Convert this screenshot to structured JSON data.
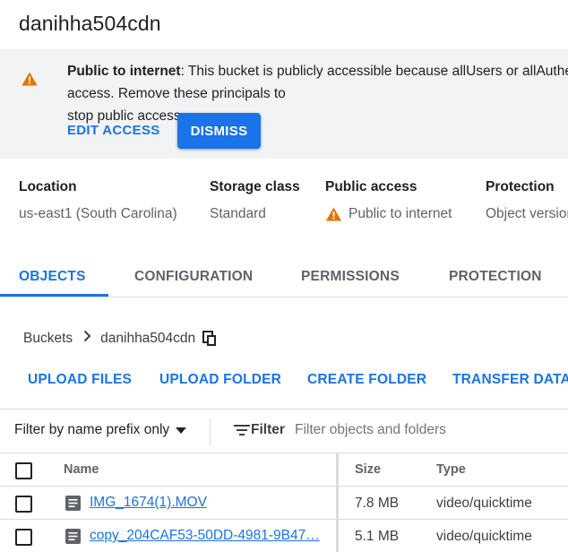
{
  "bucket": {
    "name": "danihha504cdn"
  },
  "banner": {
    "title": "Public to internet",
    "message": ": This bucket is publicly accessible because allUsers or allAuthenticatedUsers have access. Remove these principals to",
    "message_line2": "stop public access.",
    "edit_access_label": "EDIT ACCESS",
    "dismiss_label": "DISMISS",
    "icon": "warning-icon",
    "icon_color": "#e37400"
  },
  "properties": [
    {
      "label": "Location",
      "value": "us-east1 (South Carolina)"
    },
    {
      "label": "Storage class",
      "value": "Standard"
    },
    {
      "label": "Public access",
      "value": "Public to internet",
      "icon": "warning-icon"
    },
    {
      "label": "Protection",
      "value": "Object versioning"
    }
  ],
  "tabs": [
    {
      "label": "OBJECTS",
      "active": true
    },
    {
      "label": "CONFIGURATION",
      "active": false
    },
    {
      "label": "PERMISSIONS",
      "active": false
    },
    {
      "label": "PROTECTION",
      "active": false
    }
  ],
  "breadcrumb": {
    "root": "Buckets",
    "current": "danihha504cdn",
    "copy_icon": "copy-icon"
  },
  "actions": {
    "upload_files": "UPLOAD FILES",
    "upload_folder": "UPLOAD FOLDER",
    "create_folder": "CREATE FOLDER",
    "transfer_data": "TRANSFER DATA"
  },
  "filter": {
    "mode": "Filter by name prefix only",
    "button_label": "Filter",
    "placeholder": "Filter objects and folders"
  },
  "table": {
    "columns": {
      "name": "Name",
      "size": "Size",
      "type": "Type"
    },
    "rows": [
      {
        "name": "IMG_1674(1).MOV",
        "size": "7.8 MB",
        "type": "video/quicktime"
      },
      {
        "name": "copy_204CAF53-50DD-4981-9B47…",
        "size": "5.1 MB",
        "type": "video/quicktime"
      }
    ]
  },
  "colors": {
    "accent": "#1a73e8",
    "warning": "#e37400"
  }
}
